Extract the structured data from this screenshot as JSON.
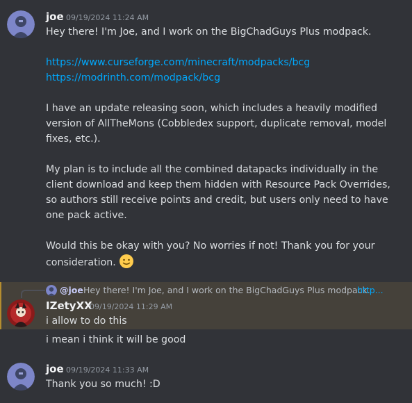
{
  "messages": [
    {
      "author": "joe",
      "timestamp": "09/19/2024 11:24 AM",
      "intro": "Hey there! I'm Joe, and I work on the BigChadGuys Plus modpack.",
      "links": [
        "https://www.curseforge.com/minecraft/modpacks/bcg",
        "https://modrinth.com/modpack/bcg"
      ],
      "para2": [
        "I have an update releasing soon, which includes a heavily modified",
        "version of AllTheMons (Cobbledex support, duplicate removal, model",
        "fixes, etc.)."
      ],
      "para3": [
        "My plan is to include all the combined datapacks individually in the",
        "client download and keep them hidden with Resource Pack Overrides,",
        "so authors still receive points and credit, but users only need to have",
        "one pack active."
      ],
      "para4": [
        "Would this be okay with you? No worries if not! Thank you for your",
        "consideration."
      ],
      "emoji": "slightly-smiling-face"
    },
    {
      "reply_to": {
        "mention": "@joe",
        "preview": "Hey there! I'm Joe, and I work on the BigChadGuys Plus modpack.",
        "link_preview": "http..."
      },
      "author": "IZetyXX",
      "timestamp": "09/19/2024 11:29 AM",
      "lines": [
        "i allow to do this",
        "i mean i think it will be good"
      ]
    },
    {
      "author": "joe",
      "timestamp": "09/19/2024 11:33 AM",
      "lines": [
        "Thank you so much! :D"
      ]
    }
  ],
  "colors": {
    "background": "#313338",
    "link": "#00a8fc",
    "highlight": "#45413a",
    "highlight_border": "#b58d2f"
  }
}
